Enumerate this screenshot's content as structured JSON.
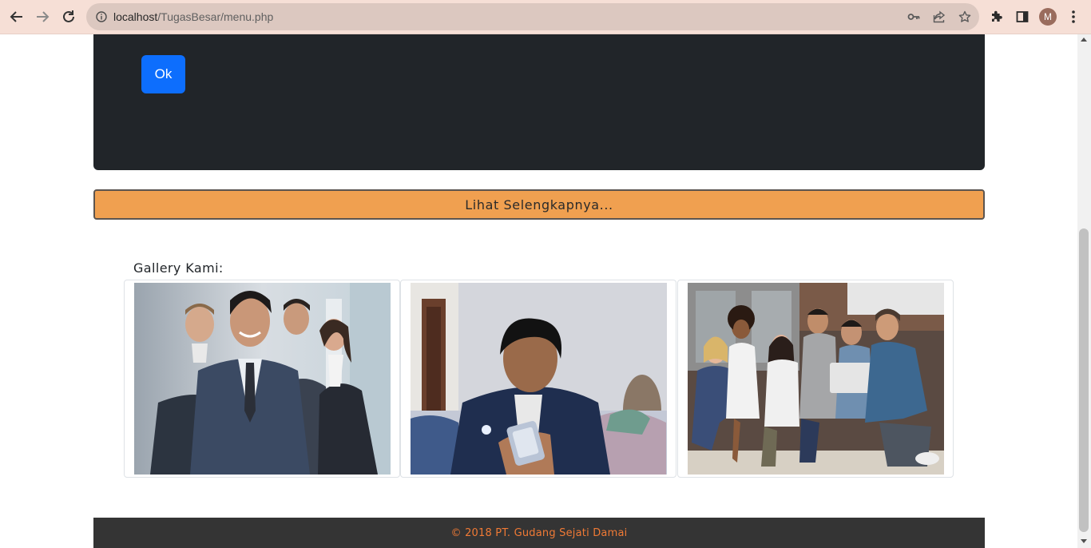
{
  "browser": {
    "url_host": "localhost",
    "url_path": "/TugasBesar/menu.php",
    "profile_initial": "M",
    "icons": [
      "back-icon",
      "forward-icon",
      "reload-icon",
      "site-info-icon",
      "key-icon",
      "share-icon",
      "bookmark-star-icon",
      "extensions-icon",
      "side-panel-icon",
      "profile-avatar",
      "menu-dots-icon"
    ]
  },
  "hero": {
    "ok_label": "Ok",
    "card_color": "#212529",
    "button_color": "#0d6efd"
  },
  "more": {
    "label": "Lihat Selengkapnya...",
    "color": "#f0a050"
  },
  "gallery": {
    "title": "Gallery Kami:",
    "images": [
      {
        "subject": "business team in suits"
      },
      {
        "subject": "young man looking at phone"
      },
      {
        "subject": "group of coworkers sitting together"
      }
    ]
  },
  "footer": {
    "text": "© 2018 PT. Gudang Sejati Damai",
    "text_color": "#f07a35"
  }
}
